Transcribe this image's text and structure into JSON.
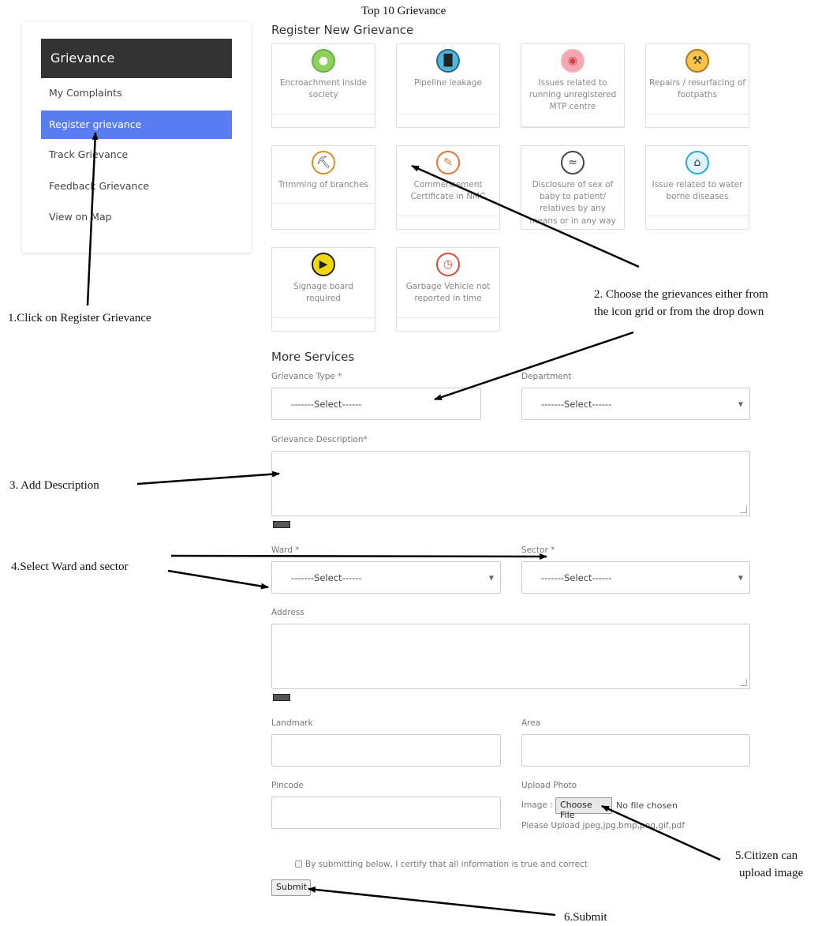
{
  "page_heading": "Top 10 Grievance",
  "sidebar": {
    "title": "Grievance",
    "items": [
      {
        "label": "My Complaints",
        "active": false
      },
      {
        "label": "Register grievance",
        "active": true
      },
      {
        "label": "Track Grievance",
        "active": false
      },
      {
        "label": "Feedback Grievance",
        "active": false
      },
      {
        "label": "View on Map",
        "active": false
      }
    ]
  },
  "register": {
    "title": "Register New Grievance",
    "cards": [
      {
        "label": "Encroachment inside society",
        "icon": "dumbbell-icon",
        "color": "#6ab04c"
      },
      {
        "label": "Pipeline leakage",
        "icon": "pipe-icon",
        "color": "#2d6a8f"
      },
      {
        "label": "Issues related to running unregistered MTP centre",
        "icon": "fetus-icon",
        "color": "#e77f8a"
      },
      {
        "label": "Repairs / resurfacing of footpaths",
        "icon": "worker-icon",
        "color": "#e5a12b"
      },
      {
        "label": "Trimming of branches",
        "icon": "axe-icon",
        "color": "#d6902a"
      },
      {
        "label": "Commencement Certificate in NMC",
        "icon": "certificate-icon",
        "color": "#e0753b"
      },
      {
        "label": "Disclosure of sex of baby to patient/ relatives by any means or in any way",
        "icon": "dna-icon",
        "color": "#444444"
      },
      {
        "label": "Issue related to water borne diseases",
        "icon": "flood-house-icon",
        "color": "#2aa7d8"
      },
      {
        "label": "Signage board required",
        "icon": "signboard-icon",
        "color": "#f0d800"
      },
      {
        "label": "Garbage Vehicle not reported in time",
        "icon": "clock-truck-icon",
        "color": "#d94a3a"
      }
    ]
  },
  "more_services": {
    "title": "More Services",
    "grievance_type": {
      "label": "Grievance Type *",
      "value": "-------Select------"
    },
    "department": {
      "label": "Department",
      "value": "-------Select------"
    },
    "description": {
      "label": "Grievance Description*"
    },
    "ward": {
      "label": "Ward *",
      "value": "-------Select------"
    },
    "sector": {
      "label": "Sector *",
      "value": "-------Select------"
    },
    "address": {
      "label": "Address"
    },
    "landmark": {
      "label": "Landmark"
    },
    "area": {
      "label": "Area"
    },
    "pincode": {
      "label": "Pincode"
    },
    "upload": {
      "label": "Upload Photo",
      "image_prefix": "Image :",
      "choose_button": "Choose File",
      "no_file": "No file chosen",
      "hint": "Please Upload jpeg,jpg,bmp,png,gif,pdf"
    },
    "certify": "By submitting below, I certify that all information is true and correct",
    "submit": "Submit"
  },
  "annotations": {
    "step1": "1.Click on Register Grievance",
    "step2_line1": "2. Choose the grievances either from",
    "step2_line2": "the icon grid or from the drop down",
    "step3": "3. Add Description",
    "step4": "4.Select Ward and sector",
    "step5_line1": "5.Citizen can",
    "step5_line2": "upload image",
    "step6": "6.Submit"
  }
}
